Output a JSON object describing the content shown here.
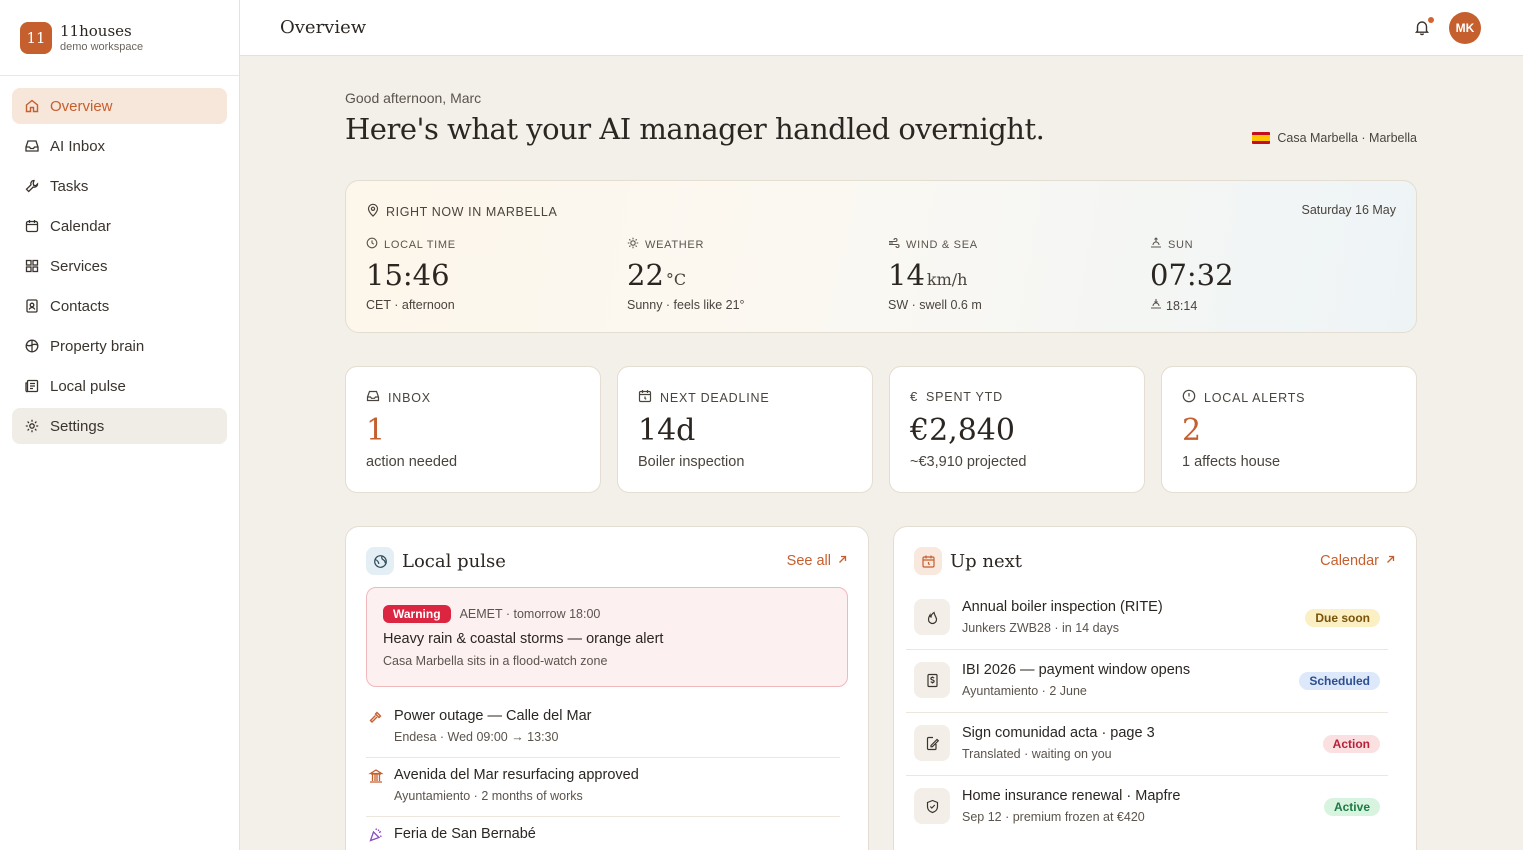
{
  "app": {
    "logo_text": "11",
    "name": "11houses",
    "workspace": "demo workspace"
  },
  "sidebar": {
    "items": [
      {
        "label": "Overview",
        "icon": "home-icon"
      },
      {
        "label": "AI Inbox",
        "icon": "inbox-icon"
      },
      {
        "label": "Tasks",
        "icon": "wrench-icon"
      },
      {
        "label": "Calendar",
        "icon": "calendar-icon"
      },
      {
        "label": "Services",
        "icon": "grid-icon"
      },
      {
        "label": "Contacts",
        "icon": "contact-card-icon"
      },
      {
        "label": "Property brain",
        "icon": "brain-icon"
      },
      {
        "label": "Local pulse",
        "icon": "newspaper-icon"
      },
      {
        "label": "Settings",
        "icon": "gear-icon"
      }
    ]
  },
  "header": {
    "title": "Overview",
    "avatar_initials": "MK"
  },
  "hero": {
    "greeting": "Good afternoon, Marc",
    "headline": "Here's what your AI manager handled overnight.",
    "location": "Casa Marbella · Marbella"
  },
  "now": {
    "heading": "RIGHT NOW IN MARBELLA",
    "date": "Saturday 16 May",
    "local_time": {
      "label": "LOCAL TIME",
      "value": "15:46",
      "sub": "CET · afternoon"
    },
    "weather": {
      "label": "WEATHER",
      "value": "22",
      "unit": "°C",
      "sub": "Sunny · feels like 21°"
    },
    "wind": {
      "label": "WIND & SEA",
      "value": "14",
      "unit": "km/h",
      "sub": "SW · swell 0.6 m"
    },
    "sun": {
      "label": "SUN",
      "value": "07:32",
      "sub": "18:14"
    }
  },
  "stats": {
    "inbox": {
      "label": "INBOX",
      "value": "1",
      "sub": "action needed"
    },
    "deadline": {
      "label": "NEXT DEADLINE",
      "value": "14d",
      "sub": "Boiler inspection"
    },
    "spent": {
      "label": "SPENT YTD",
      "value": "€2,840",
      "sub": "~€3,910 projected"
    },
    "alerts": {
      "label": "LOCAL ALERTS",
      "value": "2",
      "sub": "1 affects house"
    }
  },
  "local_pulse": {
    "title": "Local pulse",
    "link": "See all",
    "alert": {
      "badge": "Warning",
      "meta": "AEMET · tomorrow 18:00",
      "title": "Heavy rain & coastal storms — orange alert",
      "sub": "Casa Marbella sits in a flood-watch zone"
    },
    "items": [
      {
        "title": "Power outage — Calle del Mar",
        "sub": "Endesa · Wed 09:00 → 13:30",
        "icon": "hammer-icon"
      },
      {
        "title": "Avenida del Mar resurfacing approved",
        "sub": "Ayuntamiento · 2 months of works",
        "icon": "building-icon"
      },
      {
        "title": "Feria de San Bernabé",
        "sub": "",
        "icon": "party-icon"
      }
    ]
  },
  "up_next": {
    "title": "Up next",
    "link": "Calendar",
    "items": [
      {
        "title": "Annual boiler inspection (RITE)",
        "sub": "Junkers ZWB28 · in 14 days",
        "badge": "Due soon",
        "icon": "flame-icon"
      },
      {
        "title": "IBI 2026 — payment window opens",
        "sub": "Ayuntamiento · 2 June",
        "badge": "Scheduled",
        "icon": "receipt-icon"
      },
      {
        "title": "Sign comunidad acta · page 3",
        "sub": "Translated · waiting on you",
        "badge": "Action",
        "icon": "sign-document-icon"
      },
      {
        "title": "Home insurance renewal · Mapfre",
        "sub": "Sep 12 · premium frozen at €420",
        "badge": "Active",
        "icon": "shield-check-icon"
      }
    ]
  },
  "colors": {
    "accent": "#c65f2e",
    "background": "#f3f0ea",
    "warning": "#dc2641"
  }
}
